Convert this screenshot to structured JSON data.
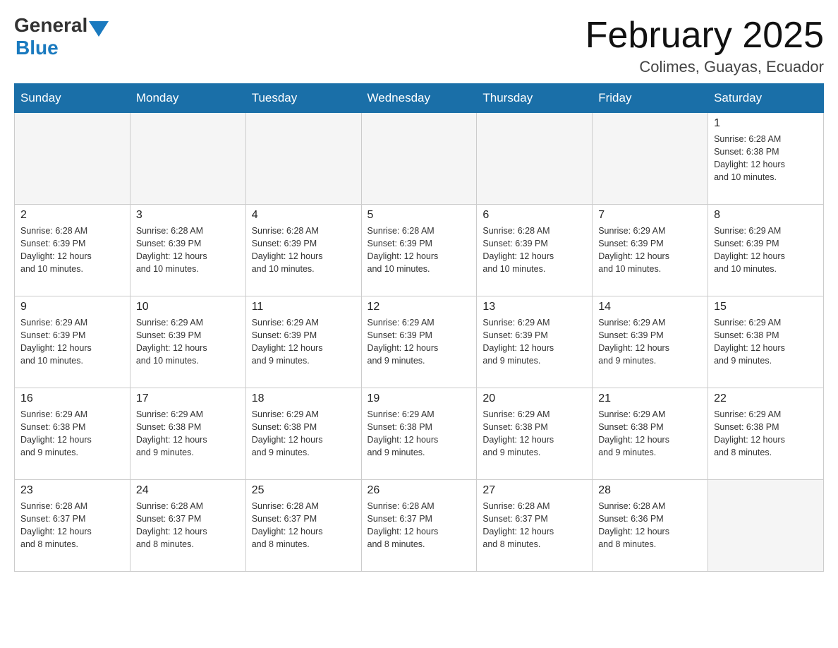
{
  "header": {
    "logo_general": "General",
    "logo_blue": "Blue",
    "month_title": "February 2025",
    "location": "Colimes, Guayas, Ecuador"
  },
  "weekdays": [
    "Sunday",
    "Monday",
    "Tuesday",
    "Wednesday",
    "Thursday",
    "Friday",
    "Saturday"
  ],
  "weeks": [
    [
      {
        "day": "",
        "info": ""
      },
      {
        "day": "",
        "info": ""
      },
      {
        "day": "",
        "info": ""
      },
      {
        "day": "",
        "info": ""
      },
      {
        "day": "",
        "info": ""
      },
      {
        "day": "",
        "info": ""
      },
      {
        "day": "1",
        "info": "Sunrise: 6:28 AM\nSunset: 6:38 PM\nDaylight: 12 hours\nand 10 minutes."
      }
    ],
    [
      {
        "day": "2",
        "info": "Sunrise: 6:28 AM\nSunset: 6:39 PM\nDaylight: 12 hours\nand 10 minutes."
      },
      {
        "day": "3",
        "info": "Sunrise: 6:28 AM\nSunset: 6:39 PM\nDaylight: 12 hours\nand 10 minutes."
      },
      {
        "day": "4",
        "info": "Sunrise: 6:28 AM\nSunset: 6:39 PM\nDaylight: 12 hours\nand 10 minutes."
      },
      {
        "day": "5",
        "info": "Sunrise: 6:28 AM\nSunset: 6:39 PM\nDaylight: 12 hours\nand 10 minutes."
      },
      {
        "day": "6",
        "info": "Sunrise: 6:28 AM\nSunset: 6:39 PM\nDaylight: 12 hours\nand 10 minutes."
      },
      {
        "day": "7",
        "info": "Sunrise: 6:29 AM\nSunset: 6:39 PM\nDaylight: 12 hours\nand 10 minutes."
      },
      {
        "day": "8",
        "info": "Sunrise: 6:29 AM\nSunset: 6:39 PM\nDaylight: 12 hours\nand 10 minutes."
      }
    ],
    [
      {
        "day": "9",
        "info": "Sunrise: 6:29 AM\nSunset: 6:39 PM\nDaylight: 12 hours\nand 10 minutes."
      },
      {
        "day": "10",
        "info": "Sunrise: 6:29 AM\nSunset: 6:39 PM\nDaylight: 12 hours\nand 10 minutes."
      },
      {
        "day": "11",
        "info": "Sunrise: 6:29 AM\nSunset: 6:39 PM\nDaylight: 12 hours\nand 9 minutes."
      },
      {
        "day": "12",
        "info": "Sunrise: 6:29 AM\nSunset: 6:39 PM\nDaylight: 12 hours\nand 9 minutes."
      },
      {
        "day": "13",
        "info": "Sunrise: 6:29 AM\nSunset: 6:39 PM\nDaylight: 12 hours\nand 9 minutes."
      },
      {
        "day": "14",
        "info": "Sunrise: 6:29 AM\nSunset: 6:39 PM\nDaylight: 12 hours\nand 9 minutes."
      },
      {
        "day": "15",
        "info": "Sunrise: 6:29 AM\nSunset: 6:38 PM\nDaylight: 12 hours\nand 9 minutes."
      }
    ],
    [
      {
        "day": "16",
        "info": "Sunrise: 6:29 AM\nSunset: 6:38 PM\nDaylight: 12 hours\nand 9 minutes."
      },
      {
        "day": "17",
        "info": "Sunrise: 6:29 AM\nSunset: 6:38 PM\nDaylight: 12 hours\nand 9 minutes."
      },
      {
        "day": "18",
        "info": "Sunrise: 6:29 AM\nSunset: 6:38 PM\nDaylight: 12 hours\nand 9 minutes."
      },
      {
        "day": "19",
        "info": "Sunrise: 6:29 AM\nSunset: 6:38 PM\nDaylight: 12 hours\nand 9 minutes."
      },
      {
        "day": "20",
        "info": "Sunrise: 6:29 AM\nSunset: 6:38 PM\nDaylight: 12 hours\nand 9 minutes."
      },
      {
        "day": "21",
        "info": "Sunrise: 6:29 AM\nSunset: 6:38 PM\nDaylight: 12 hours\nand 9 minutes."
      },
      {
        "day": "22",
        "info": "Sunrise: 6:29 AM\nSunset: 6:38 PM\nDaylight: 12 hours\nand 8 minutes."
      }
    ],
    [
      {
        "day": "23",
        "info": "Sunrise: 6:28 AM\nSunset: 6:37 PM\nDaylight: 12 hours\nand 8 minutes."
      },
      {
        "day": "24",
        "info": "Sunrise: 6:28 AM\nSunset: 6:37 PM\nDaylight: 12 hours\nand 8 minutes."
      },
      {
        "day": "25",
        "info": "Sunrise: 6:28 AM\nSunset: 6:37 PM\nDaylight: 12 hours\nand 8 minutes."
      },
      {
        "day": "26",
        "info": "Sunrise: 6:28 AM\nSunset: 6:37 PM\nDaylight: 12 hours\nand 8 minutes."
      },
      {
        "day": "27",
        "info": "Sunrise: 6:28 AM\nSunset: 6:37 PM\nDaylight: 12 hours\nand 8 minutes."
      },
      {
        "day": "28",
        "info": "Sunrise: 6:28 AM\nSunset: 6:36 PM\nDaylight: 12 hours\nand 8 minutes."
      },
      {
        "day": "",
        "info": ""
      }
    ]
  ]
}
